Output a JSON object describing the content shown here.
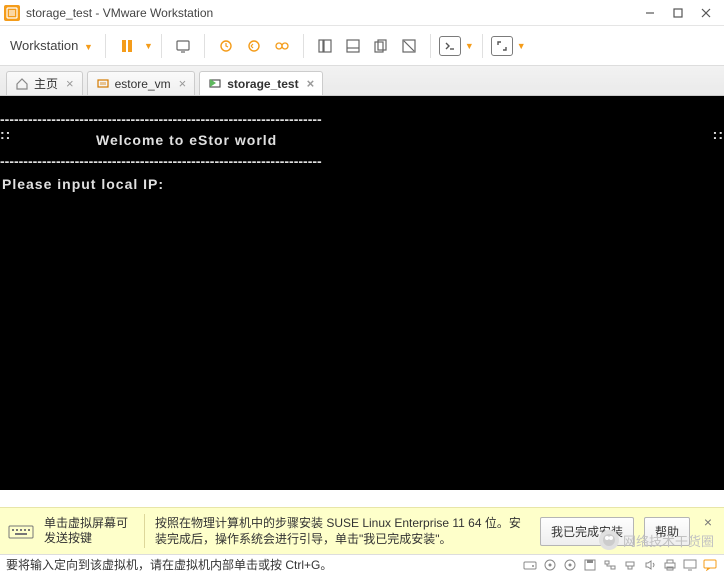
{
  "window": {
    "title": "storage_test - VMware Workstation"
  },
  "menu": {
    "workstation": "Workstation"
  },
  "tabs": {
    "home": "主页",
    "vm1": "estore_vm",
    "vm2": "storage_test"
  },
  "console": {
    "dashes": "---------------------------------------------------------------------",
    "dots": "::",
    "welcome": "Welcome to eStor world",
    "prompt": "Please input local IP:"
  },
  "infobar": {
    "hint1": "单击虚拟屏幕可发送按键",
    "hint2": "按照在物理计算机中的步骤安装 SUSE Linux Enterprise 11 64 位。安装完成后，操作系统会进行引导，单击\"我已完成安装\"。",
    "done": "我已完成安装",
    "help": "帮助"
  },
  "status": {
    "text": "要将输入定向到该虚拟机，请在虚拟机内部单击或按 Ctrl+G。"
  },
  "watermark": {
    "text": "网络技术干货圈"
  }
}
